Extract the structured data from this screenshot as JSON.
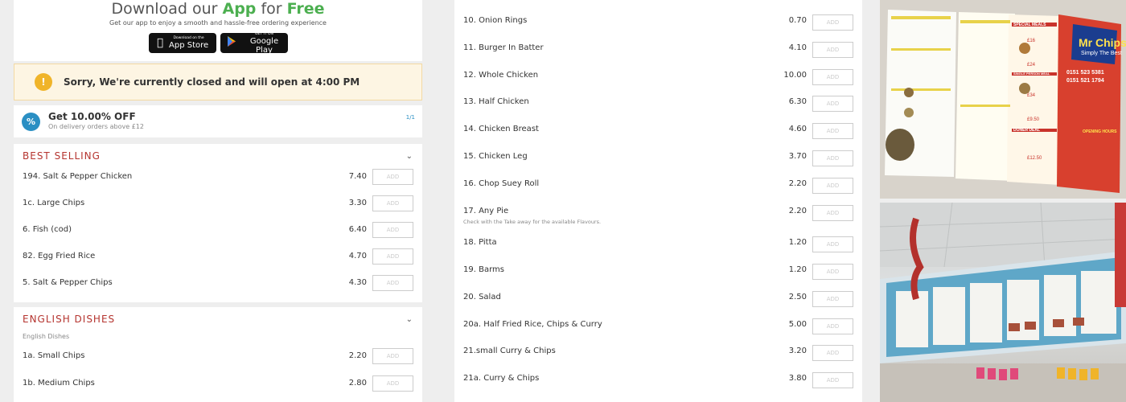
{
  "app_promo": {
    "title_prefix": "Download our",
    "title_app": "App",
    "title_mid": "for",
    "title_free": "Free",
    "subtitle": "Get our app to enjoy a smooth and hassle-free ordering experience",
    "appstore_small": "Download on the",
    "appstore_big": "App Store",
    "googleplay_small": "GET IT ON",
    "googleplay_big": "Google Play"
  },
  "closed_notice": {
    "icon": "!",
    "message": "Sorry, We're currently closed and will open at 4:00 PM"
  },
  "offer": {
    "icon": "%",
    "title": "Get 10.00% OFF",
    "subtitle": "On delivery orders above £12",
    "pager": "1/1"
  },
  "best_selling": {
    "title": "BEST SELLING",
    "items": [
      {
        "name": "194. Salt & Pepper Chicken",
        "price": "7.40",
        "add": "ADD"
      },
      {
        "name": "1c. Large Chips",
        "price": "3.30",
        "add": "ADD"
      },
      {
        "name": "6. Fish (cod)",
        "price": "6.40",
        "add": "ADD"
      },
      {
        "name": "82. Egg Fried Rice",
        "price": "4.70",
        "add": "ADD"
      },
      {
        "name": "5. Salt & Pepper Chips",
        "price": "4.30",
        "add": "ADD"
      }
    ]
  },
  "english_dishes": {
    "title": "ENGLISH DISHES",
    "description": "English Dishes",
    "items": [
      {
        "name": "1a. Small Chips",
        "price": "2.20",
        "add": "ADD"
      },
      {
        "name": "1b. Medium Chips",
        "price": "2.80",
        "add": "ADD"
      }
    ]
  },
  "menu_list": {
    "items": [
      {
        "name": "10. Onion Rings",
        "price": "0.70",
        "add": "ADD",
        "note": ""
      },
      {
        "name": "11. Burger In Batter",
        "price": "4.10",
        "add": "ADD",
        "note": ""
      },
      {
        "name": "12. Whole Chicken",
        "price": "10.00",
        "add": "ADD",
        "note": ""
      },
      {
        "name": "13. Half Chicken",
        "price": "6.30",
        "add": "ADD",
        "note": ""
      },
      {
        "name": "14. Chicken Breast",
        "price": "4.60",
        "add": "ADD",
        "note": ""
      },
      {
        "name": "15. Chicken Leg",
        "price": "3.70",
        "add": "ADD",
        "note": ""
      },
      {
        "name": "16. Chop Suey Roll",
        "price": "2.20",
        "add": "ADD",
        "note": ""
      },
      {
        "name": "17. Any Pie",
        "price": "2.20",
        "add": "ADD",
        "note": "Check with the Take away for the available Flavours."
      },
      {
        "name": "18. Pitta",
        "price": "1.20",
        "add": "ADD",
        "note": ""
      },
      {
        "name": "19. Barms",
        "price": "1.20",
        "add": "ADD",
        "note": ""
      },
      {
        "name": "20. Salad",
        "price": "2.50",
        "add": "ADD",
        "note": ""
      },
      {
        "name": "20a. Half Fried Rice, Chips & Curry",
        "price": "5.00",
        "add": "ADD",
        "note": ""
      },
      {
        "name": "21.small Curry & Chips",
        "price": "3.20",
        "add": "ADD",
        "note": ""
      },
      {
        "name": "21a. Curry & Chips",
        "price": "3.80",
        "add": "ADD",
        "note": ""
      }
    ]
  },
  "photos": {
    "menu_leaflet": {
      "brand": "Mr Chips",
      "tagline": "Simply The Best",
      "phone1": "0151 523 5381",
      "phone2": "0151 521 1794",
      "deals": [
        "SPECIAL MEALS",
        "SINGLE PERSON MEAL",
        "DONER DEAL"
      ],
      "prices": [
        "£16",
        "£24",
        "£34",
        "£9.50",
        "£12.50"
      ],
      "opening": "OPENING HOURS"
    }
  },
  "colors": {
    "accent_red": "#b5342f",
    "green": "#4caf50",
    "warning": "#f0b429",
    "offer_blue": "#2a8fc3"
  }
}
